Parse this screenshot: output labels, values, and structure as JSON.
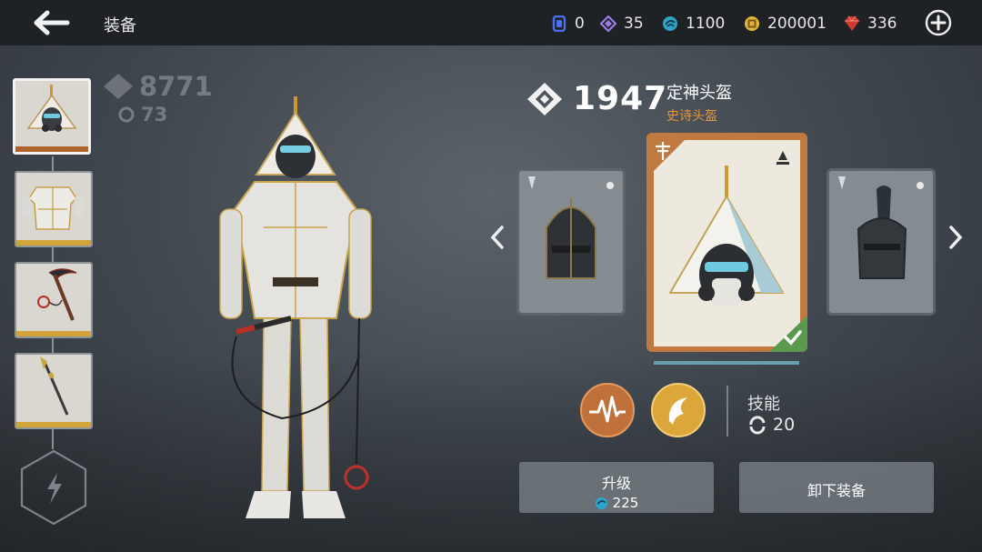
{
  "header": {
    "title": "装备"
  },
  "currencies": [
    {
      "icon": "blue-gem-icon",
      "value": "0",
      "color": "#3c5fd8"
    },
    {
      "icon": "purple-diamond-icon",
      "value": "35",
      "color": "#8c6fd6"
    },
    {
      "icon": "cyan-swirl-icon",
      "value": "1100",
      "color": "#2fa3c8"
    },
    {
      "icon": "gold-coin-icon",
      "value": "200001",
      "color": "#e3b53b"
    },
    {
      "icon": "red-ruby-icon",
      "value": "336",
      "color": "#c8322c"
    }
  ],
  "character": {
    "power": "8771",
    "upgrade_count": "73"
  },
  "equipment_slots": [
    {
      "name": "helmet",
      "selected": true
    },
    {
      "name": "armor",
      "selected": false
    },
    {
      "name": "kusarigama",
      "selected": false
    },
    {
      "name": "spear",
      "selected": false
    }
  ],
  "item": {
    "power": "1947",
    "name": "定神头盔",
    "rarity": "史诗头盔"
  },
  "skills": {
    "label": "技能",
    "value": "20"
  },
  "actions": {
    "upgrade_label": "升级",
    "upgrade_cost": "225",
    "unequip_label": "卸下装备"
  },
  "colors": {
    "accent_orange": "#c07a3f",
    "rarity_orange": "#e8963c",
    "equipped_green": "#5b9a4c"
  }
}
